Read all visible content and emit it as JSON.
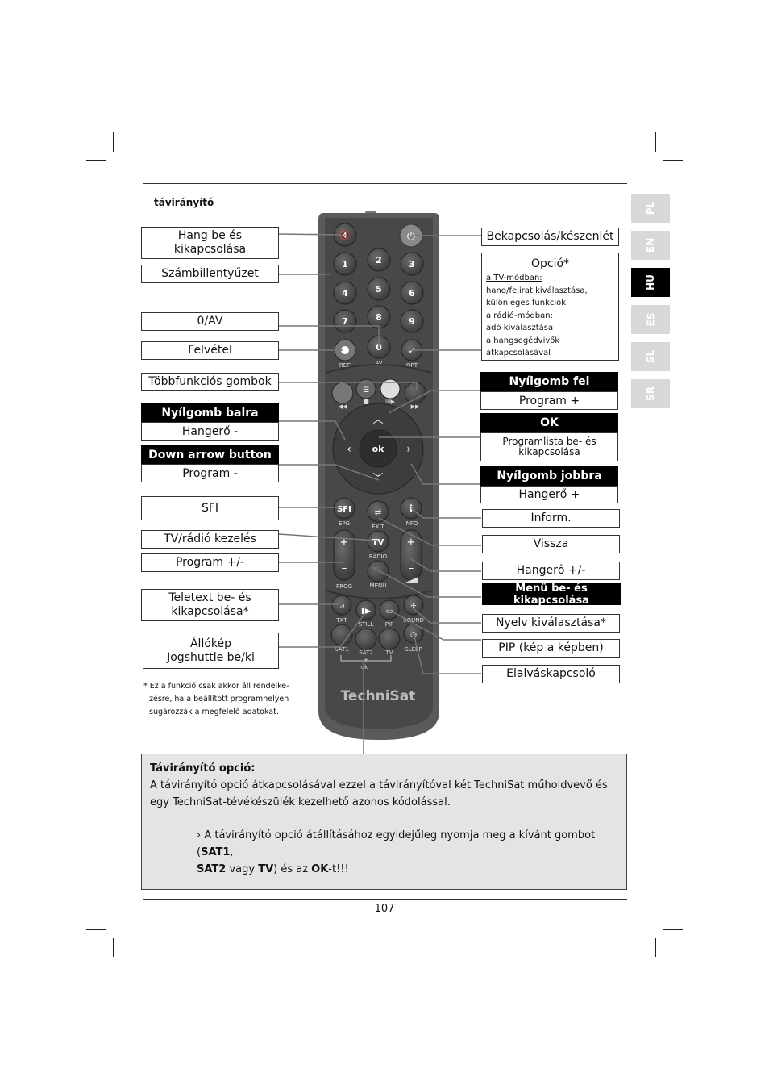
{
  "page": {
    "section_title": "távirányító",
    "page_number": "107"
  },
  "language_tabs": [
    {
      "code": "PL",
      "active": false
    },
    {
      "code": "EN",
      "active": false
    },
    {
      "code": "HU",
      "active": true
    },
    {
      "code": "ES",
      "active": false
    },
    {
      "code": "SL",
      "active": false
    },
    {
      "code": "SR",
      "active": false
    }
  ],
  "left_labels": {
    "mute": [
      "Hang be és",
      "kikapcsolása"
    ],
    "numpad": "Számbillentyűzet",
    "av": "0/AV",
    "record": "Felvétel",
    "multifunction": "Többfunkciós gombok",
    "arrow_left": {
      "title": "Nyílgomb balra",
      "sub": "Hangerő -"
    },
    "arrow_down": {
      "title": "Down arrow button",
      "sub": "Program -"
    },
    "sfi": "SFI",
    "tv_radio": "TV/rádió kezelés",
    "program_pm": "Program +/-",
    "teletext": [
      "Teletext be- és",
      "kikapcsolása*"
    ],
    "still": [
      "Állókép",
      "Jogshuttle be/ki"
    ]
  },
  "right_labels": {
    "power": "Bekapcsolás/készenlét",
    "option": {
      "title": "Opció*",
      "tv_mode_heading": "a TV-módban:",
      "tv_mode_lines": [
        "hang/felirat kiválasztása,",
        "különleges funkciók"
      ],
      "radio_mode_heading": "a rádió-módban:",
      "radio_mode_lines": [
        "adó kiválasztása",
        "a hangsegédvivők",
        "átkapcsolásával"
      ]
    },
    "arrow_up": {
      "title": "Nyílgomb fel",
      "sub": "Program +"
    },
    "ok": {
      "title": "OK",
      "sub": [
        "Programlista be- és",
        "kikapcsolása"
      ]
    },
    "arrow_right": {
      "title": "Nyílgomb jobbra",
      "sub": "Hangerő +"
    },
    "info": "Inform.",
    "back": "Vissza",
    "volume_pm": "Hangerő +/-",
    "menu": "Menü be- és kikapcsolása",
    "language": "Nyelv kiválasztása*",
    "pip": "PIP (kép a képben)",
    "sleep": "Elalváskapcsoló"
  },
  "footnote": [
    "* Ez a funkció csak akkor áll rendelke-",
    "zésre, ha a beállított programhelyen",
    "sugározzák a megfelelő adatokat."
  ],
  "remote": {
    "brand": "TechniSat",
    "keys": {
      "numbers": [
        "1",
        "2",
        "3",
        "4",
        "5",
        "6",
        "7",
        "8",
        "9",
        "0"
      ],
      "rec": "REC",
      "av": "AV",
      "opt": "OPT",
      "ok": "ok",
      "sfi": "SFI",
      "epg": "EPG",
      "exit": "EXIT",
      "info_key": "i",
      "info": "INFO",
      "tv": "TV",
      "radio": "RADIO",
      "prog": "PROG",
      "menu": "MENU",
      "plus": "+",
      "minus": "–",
      "txt": "TXT",
      "still": "STILL",
      "pip": "PIP",
      "sound": "SOUND",
      "sat1": "SAT1",
      "sat2": "SAT2",
      "tv_small": "TV",
      "sleep": "SLEEP",
      "combo_plus": "+",
      "combo_ok": "ok"
    }
  },
  "infobox": {
    "title": "Távirányító opció:",
    "body": [
      "A távirányító opció átkapcsolásával ezzel a távirányítóval két TechniSat műholdvevő és",
      "egy TechniSat-tévékészülék kezelhető azonos kódolással."
    ],
    "step_prefix": "› A távirányító opció átállításához egyidejűleg nyomja meg a kívánt gombot (",
    "sat1": "SAT1",
    "sep1": ",",
    "sat2": "SAT2",
    "mid": " vagy ",
    "tv": "TV",
    "mid2": ") és az ",
    "ok": "OK",
    "end": "-t!!!"
  }
}
